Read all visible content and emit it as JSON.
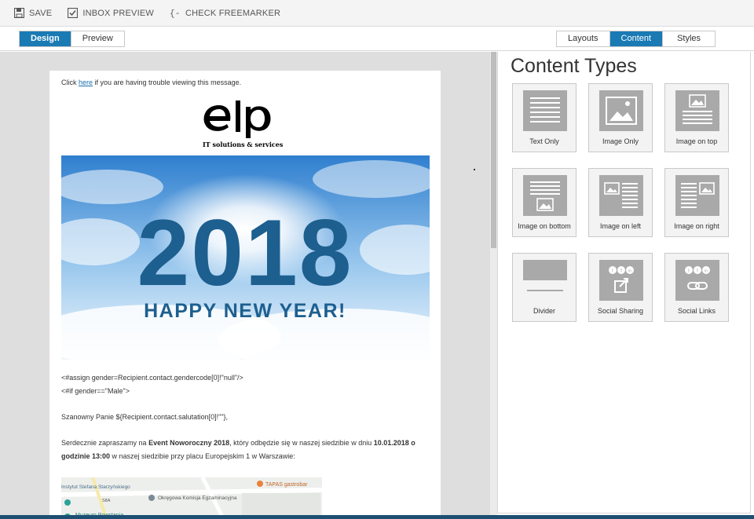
{
  "toolbar": {
    "save_label": "SAVE",
    "inbox_preview_label": "INBOX PREVIEW",
    "check_freemarker_label": "CHECK FREEMARKER"
  },
  "mode_tabs": {
    "design": "Design",
    "preview": "Preview"
  },
  "panel_tabs": {
    "layouts": "Layouts",
    "content": "Content",
    "styles": "Styles"
  },
  "email": {
    "trouble_prefix": "Click ",
    "trouble_link": "here",
    "trouble_suffix": " if you are having trouble viewing this message.",
    "logo_tagline": "IT solutions & services",
    "hero_year": "2018",
    "hero_greeting": "HAPPY NEW YEAR!",
    "line1": "<#assign gender=Recipient.contact.gendercode[0]!\"null\"/>",
    "line2": "<#if gender==\"Male\">",
    "line3": "Szanowny Panie ${Recipient.contact.salutation[0]!\"\"},",
    "line4_a": "Serdecznie zapraszamy na ",
    "line4_b": "Event Noworoczny 2018",
    "line4_c": ", który odbędzie się w naszej siedzibie w dniu ",
    "line4_d": "10.01.2018 o godzinie 13:00",
    "line4_e": " w naszej siedzibie przy placu Europejskim 1 w Warszawie:",
    "map_label_1": "Instytut Stefana Starzyńskiego",
    "map_label_2": "Okręgowa Komisja Egzaminacyjna",
    "map_label_3": "TAPAS gastrobar",
    "map_label_4": "Muzeum Powstania",
    "map_label_5": "S8A"
  },
  "panel": {
    "title": "Content Types",
    "tiles": [
      {
        "label": "Text Only",
        "icon": "text-only-icon"
      },
      {
        "label": "Image Only",
        "icon": "image-only-icon"
      },
      {
        "label": "Image on top",
        "icon": "image-on-top-icon"
      },
      {
        "label": "Image on bottom",
        "icon": "image-on-bottom-icon"
      },
      {
        "label": "Image on left",
        "icon": "image-on-left-icon"
      },
      {
        "label": "Image on right",
        "icon": "image-on-right-icon"
      },
      {
        "label": "Divider",
        "icon": "divider-icon"
      },
      {
        "label": "Social Sharing",
        "icon": "social-sharing-icon"
      },
      {
        "label": "Social Links",
        "icon": "social-links-icon"
      }
    ]
  },
  "colors": {
    "accent": "#1a7ab4",
    "tile_gray": "#a9a9a9",
    "canvas_bg": "#dedede"
  }
}
